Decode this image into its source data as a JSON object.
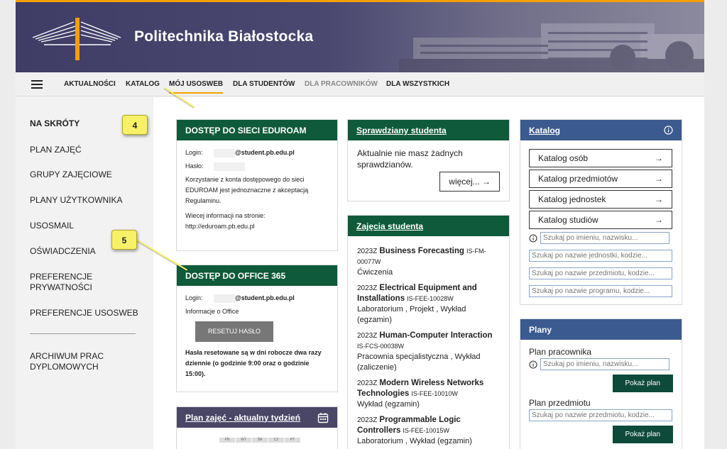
{
  "header": {
    "brand": "Politechnika Białostocka"
  },
  "nav": {
    "items": [
      {
        "label": "AKTUALNOŚCI",
        "state": "normal"
      },
      {
        "label": "KATALOG",
        "state": "normal"
      },
      {
        "label": "MÓJ USOSWEB",
        "state": "active"
      },
      {
        "label": "DLA STUDENTÓW",
        "state": "normal"
      },
      {
        "label": "DLA PRACOWNIKÓW",
        "state": "muted"
      },
      {
        "label": "DLA WSZYSTKICH",
        "state": "normal"
      }
    ]
  },
  "sidebar": {
    "items": [
      {
        "label": "NA SKRÓTY"
      },
      {
        "label": "PLAN ZAJĘĆ"
      },
      {
        "label": "GRUPY ZAJĘCIOWE"
      },
      {
        "label": "PLANY UŻYTKOWNIKA"
      },
      {
        "label": "USOSMAIL"
      },
      {
        "label": "OŚWIADCZENIA"
      },
      {
        "label": "PREFERENCJE PRYWATNOŚCI"
      },
      {
        "label": "PREFERENCJE USOSWEB"
      },
      {
        "label": "ARCHIWUM PRAC DYPLOMOWYCH"
      }
    ]
  },
  "eduroam": {
    "title": "DOSTĘP DO SIECI EDUROAM",
    "login_label": "Login:",
    "login_domain": "@student.pb.edu.pl",
    "password_label": "Hasło:",
    "info": "Korzystanie z konta dostępowego do sieci EDUROAM jest jednoznaczne z akceptacją Regulaminu.",
    "more": "Wiecej informacji na stronie: http://eduroam.pb.edu.pl"
  },
  "office": {
    "title": "DOSTĘP DO OFFICE 365",
    "login_label": "Login:",
    "login_domain": "@student.pb.edu.pl",
    "info": "Informacje o Office",
    "reset_button": "RESETUJ HASŁO",
    "note": "Hasła resetowane są w dni robocze dwa razy dziennie (o godzinie 9:00 oraz o godzinie 15:00)."
  },
  "schedule": {
    "title": "Plan zajęć - aktualny tydzień",
    "days": [
      "PN",
      "WT",
      "ŚR",
      "CZ",
      "PT"
    ]
  },
  "tests": {
    "title": "Sprawdziany studenta",
    "text": "Aktualnie nie masz żadnych sprawdzianów.",
    "more_button": "więcej...",
    "arrow": "→"
  },
  "classes": {
    "title": "Zajęcia studenta",
    "items": [
      {
        "term": "2023Z",
        "name": "Business Forecasting",
        "code": "IS-FM-00077W",
        "types": "Ćwiczenia"
      },
      {
        "term": "2023Z",
        "name": "Electrical Equipment and Installations",
        "code": "IS-FEE-10028W",
        "types": "Laboratorium , Projekt , Wykład (egzamin)"
      },
      {
        "term": "2023Z",
        "name": "Human-Computer Interaction",
        "code": "IS-FCS-00038W",
        "types": "Pracownia specjalistyczna , Wykład (zaliczenie)"
      },
      {
        "term": "2023Z",
        "name": "Modern Wireless Networks Technologies",
        "code": "IS-FEE-10010W",
        "types": "Wykład (egzamin)"
      },
      {
        "term": "2023Z",
        "name": "Programmable Logic Controllers",
        "code": "IS-FEE-10015W",
        "types": "Laboratorium , Wykład (egzamin)"
      }
    ]
  },
  "catalog": {
    "title": "Katalog",
    "buttons": [
      {
        "label": "Katalog osób"
      },
      {
        "label": "Katalog przedmiotów"
      },
      {
        "label": "Katalog jednostek"
      },
      {
        "label": "Katalog studiów"
      }
    ],
    "arrow": "→",
    "searches": [
      {
        "placeholder": "Szukaj po imieniu, nazwisku..."
      },
      {
        "placeholder": "Szukaj po nazwie jednostki, kodzie..."
      },
      {
        "placeholder": "Szukaj po nazwie przedmiotu, kodzie..."
      },
      {
        "placeholder": "Szukaj po nazwie programu, kodzie..."
      }
    ]
  },
  "plans": {
    "title": "Plany",
    "employee_label": "Plan pracownika",
    "employee_placeholder": "Szukaj po imieniu, nazwisku...",
    "course_label": "Plan przedmiotu",
    "course_placeholder": "Szukaj po nazwie przedmiotu, kodzie...",
    "show_button": "Pokaż plan"
  },
  "annotations": {
    "badge4": "4",
    "badge5": "5"
  },
  "colors": {
    "accent": "#f4a000",
    "green_header": "#0e5a3a",
    "blue_header": "#3b5a8f",
    "banner": "#3f3c66",
    "badge": "#f7f16a"
  }
}
